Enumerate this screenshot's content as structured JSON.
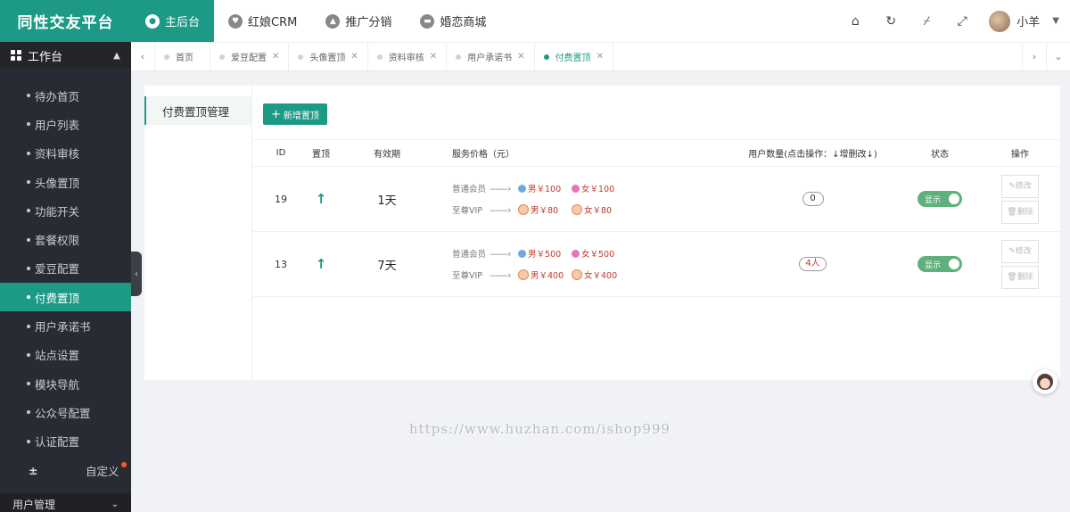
{
  "brand": "同性交友平台",
  "sidebar": {
    "head": "工作台",
    "items": [
      {
        "label": "待办首页"
      },
      {
        "label": "用户列表"
      },
      {
        "label": "资料审核"
      },
      {
        "label": "头像置顶"
      },
      {
        "label": "功能开关"
      },
      {
        "label": "套餐权限"
      },
      {
        "label": "爱豆配置"
      },
      {
        "label": "付费置顶",
        "active": true
      },
      {
        "label": "用户承诺书"
      },
      {
        "label": "站点设置"
      },
      {
        "label": "模块导航"
      },
      {
        "label": "公众号配置"
      },
      {
        "label": "认证配置"
      },
      {
        "label": "自定义"
      }
    ],
    "foot": "用户管理"
  },
  "topnav": {
    "items": [
      "主后台",
      "红娘CRM",
      "推广分销",
      "婚恋商城"
    ],
    "username": "小羊"
  },
  "tabs": [
    "首页",
    "爱豆配置",
    "头像置顶",
    "资料审核",
    "用户承诺书",
    "付费置顶"
  ],
  "subnav": "付费置顶管理",
  "add_button": "新增置顶",
  "table": {
    "headers": [
      "ID",
      "置顶",
      "有效期",
      "服务价格（元）",
      "用户数量(点击操作：↓增删改↓)",
      "状态",
      "操作"
    ],
    "rows": [
      {
        "id": "19",
        "valid": "1天",
        "normal_label": "普通会员",
        "normal_male": "男￥100",
        "normal_female": "女￥100",
        "vip_label": "至尊VIP",
        "vip_male": "男￥80",
        "vip_female": "女￥80",
        "count": "0",
        "status": "显示",
        "edit": "修改",
        "delete": "删除"
      },
      {
        "id": "13",
        "valid": "7天",
        "normal_label": "普通会员",
        "normal_male": "男￥500",
        "normal_female": "女￥500",
        "vip_label": "至尊VIP",
        "vip_male": "男￥400",
        "vip_female": "女￥400",
        "count": "4人",
        "status": "显示",
        "edit": "修改",
        "delete": "删除"
      }
    ]
  },
  "watermark": "https://www.huzhan.com/ishop999",
  "colors": {
    "accent": "#1d9a86",
    "sidebar": "#282b33",
    "price": "#c0392b",
    "switch": "#5fb07d"
  }
}
